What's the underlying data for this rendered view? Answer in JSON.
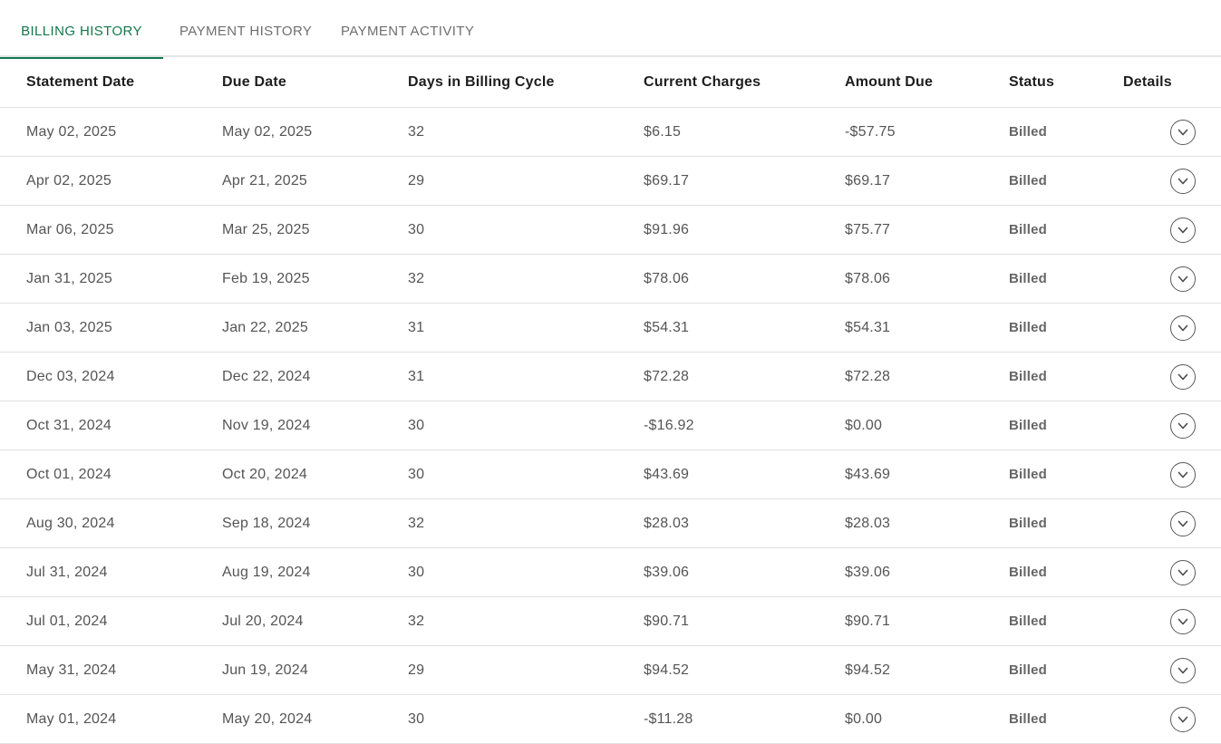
{
  "tabs": [
    {
      "label": "BILLING HISTORY",
      "active": true
    },
    {
      "label": "PAYMENT HISTORY",
      "active": false
    },
    {
      "label": "PAYMENT ACTIVITY",
      "active": false
    }
  ],
  "colors": {
    "accent": "#12784c",
    "text": "#555555",
    "header_text": "#1d1d1d",
    "divider": "#e1e1e1"
  },
  "table": {
    "columns": [
      "Statement Date",
      "Due Date",
      "Days in Billing Cycle",
      "Current Charges",
      "Amount Due",
      "Status",
      "Details"
    ],
    "rows": [
      {
        "statement_date": "May 02, 2025",
        "due_date": "May 02, 2025",
        "days": "32",
        "current_charges": "$6.15",
        "amount_due": "-$57.75",
        "status": "Billed",
        "details_icon": "chevron-down-circle-icon"
      },
      {
        "statement_date": "Apr 02, 2025",
        "due_date": "Apr 21, 2025",
        "days": "29",
        "current_charges": "$69.17",
        "amount_due": "$69.17",
        "status": "Billed",
        "details_icon": "chevron-down-circle-icon"
      },
      {
        "statement_date": "Mar 06, 2025",
        "due_date": "Mar 25, 2025",
        "days": "30",
        "current_charges": "$91.96",
        "amount_due": "$75.77",
        "status": "Billed",
        "details_icon": "chevron-down-circle-icon"
      },
      {
        "statement_date": "Jan 31, 2025",
        "due_date": "Feb 19, 2025",
        "days": "32",
        "current_charges": "$78.06",
        "amount_due": "$78.06",
        "status": "Billed",
        "details_icon": "chevron-down-circle-icon"
      },
      {
        "statement_date": "Jan 03, 2025",
        "due_date": "Jan 22, 2025",
        "days": "31",
        "current_charges": "$54.31",
        "amount_due": "$54.31",
        "status": "Billed",
        "details_icon": "chevron-down-circle-icon"
      },
      {
        "statement_date": "Dec 03, 2024",
        "due_date": "Dec 22, 2024",
        "days": "31",
        "current_charges": "$72.28",
        "amount_due": "$72.28",
        "status": "Billed",
        "details_icon": "chevron-down-circle-icon"
      },
      {
        "statement_date": "Oct 31, 2024",
        "due_date": "Nov 19, 2024",
        "days": "30",
        "current_charges": "-$16.92",
        "amount_due": "$0.00",
        "status": "Billed",
        "details_icon": "chevron-down-circle-icon"
      },
      {
        "statement_date": "Oct 01, 2024",
        "due_date": "Oct 20, 2024",
        "days": "30",
        "current_charges": "$43.69",
        "amount_due": "$43.69",
        "status": "Billed",
        "details_icon": "chevron-down-circle-icon"
      },
      {
        "statement_date": "Aug 30, 2024",
        "due_date": "Sep 18, 2024",
        "days": "32",
        "current_charges": "$28.03",
        "amount_due": "$28.03",
        "status": "Billed",
        "details_icon": "chevron-down-circle-icon"
      },
      {
        "statement_date": "Jul 31, 2024",
        "due_date": "Aug 19, 2024",
        "days": "30",
        "current_charges": "$39.06",
        "amount_due": "$39.06",
        "status": "Billed",
        "details_icon": "chevron-down-circle-icon"
      },
      {
        "statement_date": "Jul 01, 2024",
        "due_date": "Jul 20, 2024",
        "days": "32",
        "current_charges": "$90.71",
        "amount_due": "$90.71",
        "status": "Billed",
        "details_icon": "chevron-down-circle-icon"
      },
      {
        "statement_date": "May 31, 2024",
        "due_date": "Jun 19, 2024",
        "days": "29",
        "current_charges": "$94.52",
        "amount_due": "$94.52",
        "status": "Billed",
        "details_icon": "chevron-down-circle-icon"
      },
      {
        "statement_date": "May 01, 2024",
        "due_date": "May 20, 2024",
        "days": "30",
        "current_charges": "-$11.28",
        "amount_due": "$0.00",
        "status": "Billed",
        "details_icon": "chevron-down-circle-icon"
      }
    ]
  }
}
